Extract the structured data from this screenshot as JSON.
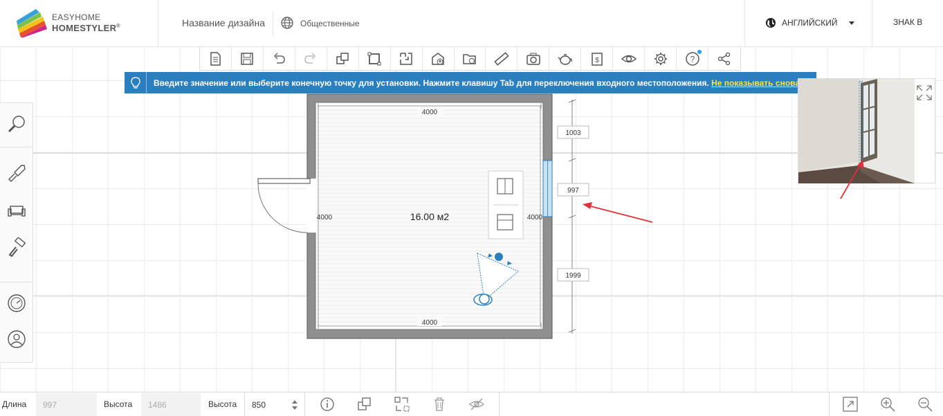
{
  "header": {
    "logo_line1": "EASYHOME",
    "logo_line2": "HOMESTYLER",
    "logo_mark": "®",
    "design_name": "Название дизайна",
    "visibility": "Общественные",
    "language": "АНГЛИЙСКИЙ",
    "signin": "ЗНАК В"
  },
  "toolbar": {
    "items": [
      {
        "name": "new-file-icon"
      },
      {
        "name": "save-icon"
      },
      {
        "name": "undo-icon"
      },
      {
        "name": "redo-icon"
      },
      {
        "name": "copy-icon"
      },
      {
        "name": "draw-room-icon"
      },
      {
        "name": "draw-wall-icon"
      },
      {
        "name": "import-icon"
      },
      {
        "name": "open-folder-icon"
      },
      {
        "name": "ruler-icon"
      },
      {
        "name": "camera-icon"
      },
      {
        "name": "teapot-icon"
      },
      {
        "name": "cost-icon"
      },
      {
        "name": "eye-icon"
      },
      {
        "name": "settings-icon"
      },
      {
        "name": "help-icon"
      },
      {
        "name": "share-icon"
      }
    ]
  },
  "banner": {
    "text": "Введите значение или выберите конечную точку для установки. Нажмите клавишу Tab для переключения входного местоположения.",
    "link": "Не показывать снова",
    "suffix": ".",
    "icon": "lightbulb-icon"
  },
  "sidebar": {
    "items": [
      {
        "name": "search-icon"
      },
      {
        "name": "build-icon"
      },
      {
        "name": "furniture-icon"
      },
      {
        "name": "paint-roller-icon"
      },
      {
        "name": "compass-icon"
      },
      {
        "name": "user-icon"
      }
    ]
  },
  "plan": {
    "top_dim": "4000",
    "bottom_dim": "4000",
    "left_dim": "4000",
    "right_dim": "4000",
    "area": "16.00 м2",
    "seg1": "1003",
    "seg2": "997",
    "seg3": "1999"
  },
  "bottombar": {
    "length_label": "Длина",
    "length_value": "997",
    "height_label": "Высота",
    "height_value": "1486",
    "elevation_label": "Высота",
    "elevation_value": "850"
  },
  "colors": {
    "banner": "#2c7fbf",
    "link": "#f5e84b",
    "wall": "#8f8f8f",
    "window": "#c9e2f2",
    "arrow": "#e0303a"
  }
}
